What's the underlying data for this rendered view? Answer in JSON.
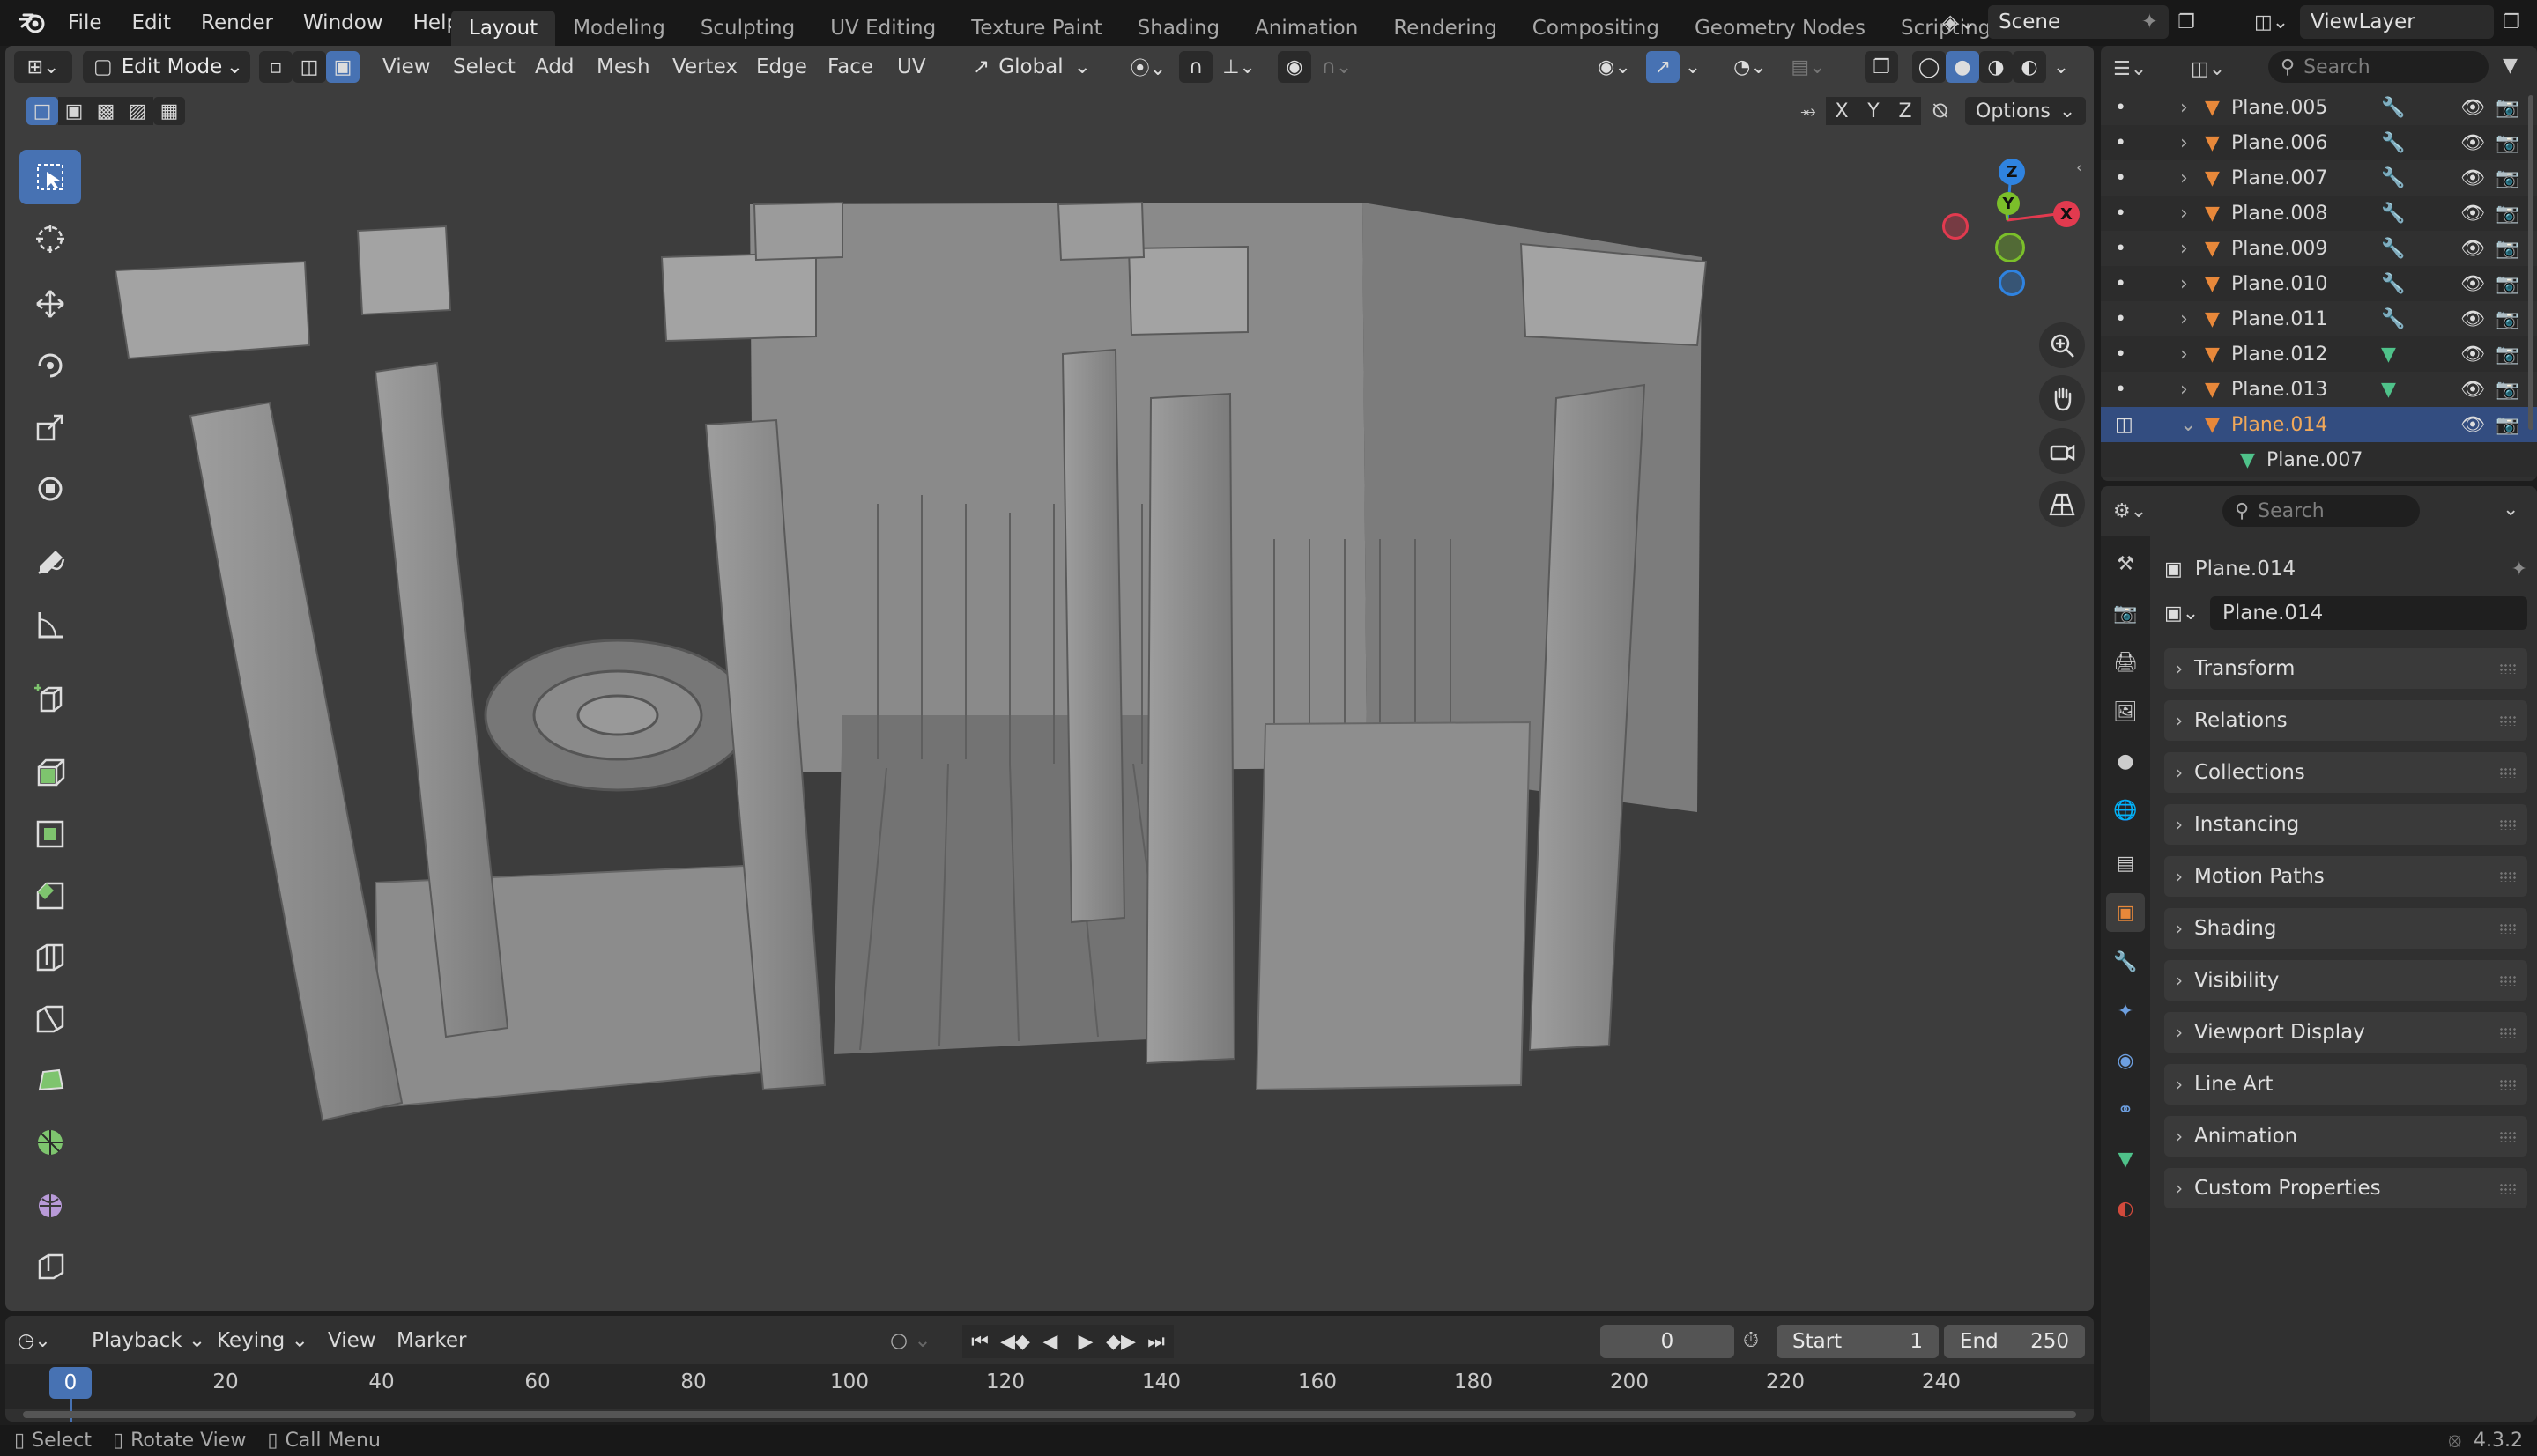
{
  "app": {
    "menus": [
      "File",
      "Edit",
      "Render",
      "Window",
      "Help"
    ],
    "workspaces": [
      "Layout",
      "Modeling",
      "Sculpting",
      "UV Editing",
      "Texture Paint",
      "Shading",
      "Animation",
      "Rendering",
      "Compositing",
      "Geometry Nodes",
      "Scripting"
    ],
    "active_workspace": "Layout",
    "scene_label": "Scene",
    "view_layer_label": "ViewLayer",
    "version": "4.3.2"
  },
  "viewport": {
    "mode": "Edit Mode",
    "menus": [
      "View",
      "Select",
      "Add",
      "Mesh",
      "Vertex",
      "Edge",
      "Face",
      "UV"
    ],
    "transform_orientation": "Global",
    "axes": [
      "X",
      "Y",
      "Z"
    ],
    "options_label": "Options",
    "gizmo": {
      "x": "X",
      "y": "Y",
      "z": "Z"
    },
    "tools": [
      "select-box-tool",
      "cursor-tool",
      "move-tool",
      "rotate-tool",
      "scale-tool",
      "transform-tool",
      "annotate-tool",
      "measure-tool",
      "add-cube-tool",
      "extrude-tool",
      "inset-tool",
      "bevel-tool",
      "loop-cut-tool",
      "knife-tool",
      "poly-build-tool",
      "spin-tool",
      "smooth-tool",
      "shrink-fatten-tool"
    ]
  },
  "timeline": {
    "menus": [
      "Playback",
      "Keying",
      "View",
      "Marker"
    ],
    "current_frame": "0",
    "start_label": "Start",
    "start_value": "1",
    "end_label": "End",
    "end_value": "250",
    "ticks": [
      "0",
      "20",
      "40",
      "60",
      "80",
      "100",
      "120",
      "140",
      "160",
      "180",
      "200",
      "220",
      "240"
    ]
  },
  "statusbar": {
    "select": "Select",
    "rotate_view": "Rotate View",
    "call_menu": "Call Menu"
  },
  "outliner": {
    "search_placeholder": "Search",
    "items": [
      {
        "name": "Plane.005",
        "modifier": "wrench"
      },
      {
        "name": "Plane.006",
        "modifier": "wrench"
      },
      {
        "name": "Plane.007",
        "modifier": "wrench"
      },
      {
        "name": "Plane.008",
        "modifier": "wrench"
      },
      {
        "name": "Plane.009",
        "modifier": "wrench"
      },
      {
        "name": "Plane.010",
        "modifier": "wrench"
      },
      {
        "name": "Plane.011",
        "modifier": "wrench"
      },
      {
        "name": "Plane.012",
        "modifier": "mesh"
      },
      {
        "name": "Plane.013",
        "modifier": "mesh"
      },
      {
        "name": "Plane.014",
        "modifier": "none",
        "selected": true
      }
    ],
    "child_mesh": "Plane.007"
  },
  "properties": {
    "search_placeholder": "Search",
    "object_name": "Plane.014",
    "object_field": "Plane.014",
    "panels": [
      "Transform",
      "Relations",
      "Collections",
      "Instancing",
      "Motion Paths",
      "Shading",
      "Visibility",
      "Viewport Display",
      "Line Art",
      "Animation",
      "Custom Properties"
    ]
  },
  "colors": {
    "accent": "#4772b3",
    "selected_row": "#334d80",
    "object_orange": "#e8883a",
    "mesh_green": "#4fc28a",
    "wrench_blue": "#6d9fe0",
    "axis_x": "#e23a4f",
    "axis_y": "#7bbf2a",
    "axis_z": "#2f83e0"
  }
}
